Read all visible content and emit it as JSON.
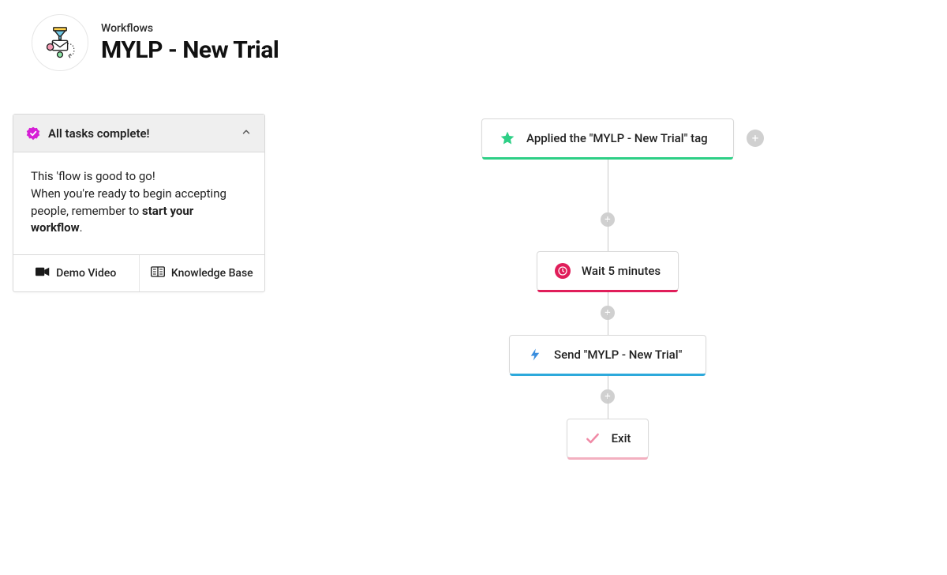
{
  "header": {
    "breadcrumb": "Workflows",
    "title": "MYLP - New Trial"
  },
  "panel": {
    "title": "All tasks complete!",
    "body_line1": "This 'flow is good to go!",
    "body_line2": "When you're ready to begin accepting people, remember to ",
    "body_bold": "start your workflow",
    "body_tail": ".",
    "footer": {
      "demo_video": "Demo Video",
      "knowledge_base": "Knowledge Base"
    }
  },
  "nodes": {
    "trigger": "Applied the \"MYLP - New Trial\" tag",
    "wait": "Wait 5 minutes",
    "send": "Send \"MYLP - New Trial\"",
    "exit": "Exit"
  },
  "icons": {
    "add": "+"
  }
}
